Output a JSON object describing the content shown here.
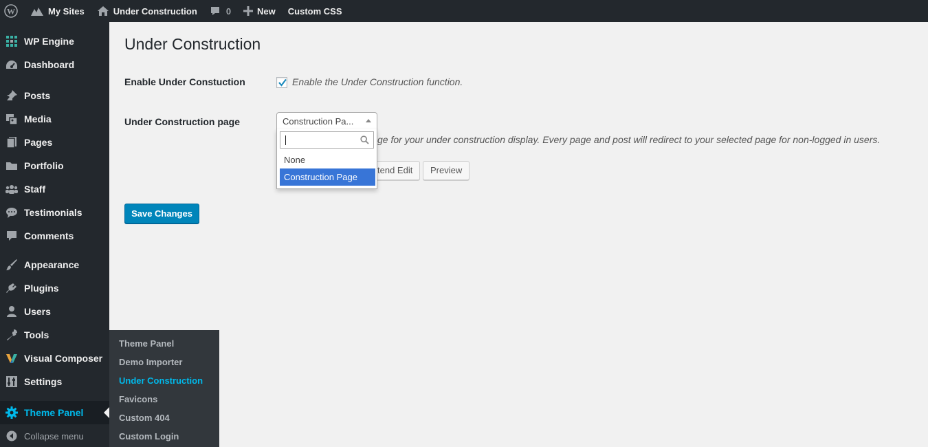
{
  "admin_bar": {
    "my_sites": "My Sites",
    "site_name": "Under Construction",
    "comments_count": "0",
    "new_label": "New",
    "custom_css": "Custom CSS"
  },
  "sidebar": {
    "items": [
      {
        "label": "WP Engine",
        "icon": "wp-engine-grid-icon"
      },
      {
        "label": "Dashboard",
        "icon": "dashboard-icon"
      },
      {
        "label": "Posts",
        "icon": "pin-icon"
      },
      {
        "label": "Media",
        "icon": "media-icon"
      },
      {
        "label": "Pages",
        "icon": "pages-icon"
      },
      {
        "label": "Portfolio",
        "icon": "folder-icon"
      },
      {
        "label": "Staff",
        "icon": "groups-icon"
      },
      {
        "label": "Testimonials",
        "icon": "speech-bubble-icon"
      },
      {
        "label": "Comments",
        "icon": "comment-icon"
      },
      {
        "label": "Appearance",
        "icon": "paintbrush-icon"
      },
      {
        "label": "Plugins",
        "icon": "plug-icon"
      },
      {
        "label": "Users",
        "icon": "user-icon"
      },
      {
        "label": "Tools",
        "icon": "wrench-icon"
      },
      {
        "label": "Visual Composer",
        "icon": "visual-composer-icon"
      },
      {
        "label": "Settings",
        "icon": "settings-icon"
      },
      {
        "label": "Theme Panel",
        "icon": "gear-icon"
      },
      {
        "label": "Collapse menu",
        "icon": "collapse-arrow-icon"
      }
    ]
  },
  "flyout": {
    "items": [
      "Theme Panel",
      "Demo Importer",
      "Under Construction",
      "Favicons",
      "Custom 404",
      "Custom Login"
    ],
    "active": "Under Construction"
  },
  "main": {
    "title": "Under Construction",
    "enable_label": "Enable Under Constuction",
    "enable_desc": "Enable the Under Construction function.",
    "enable_checked": true,
    "page_label": "Under Construction page",
    "page_select_value": "Construction Pa...",
    "page_desc": "ge for your under construction display. Every page and post will redirect to your selected page for non-logged in users.",
    "dropdown_options": [
      "None",
      "Construction Page"
    ],
    "dropdown_highlighted": "Construction Page",
    "frontend_edit": "tend Edit",
    "preview": "Preview",
    "save": "Save Changes"
  },
  "colors": {
    "accent": "#00b9eb",
    "primary_button": "#0085ba",
    "sidebar_bg": "#23282d",
    "highlight": "#3875d7"
  }
}
